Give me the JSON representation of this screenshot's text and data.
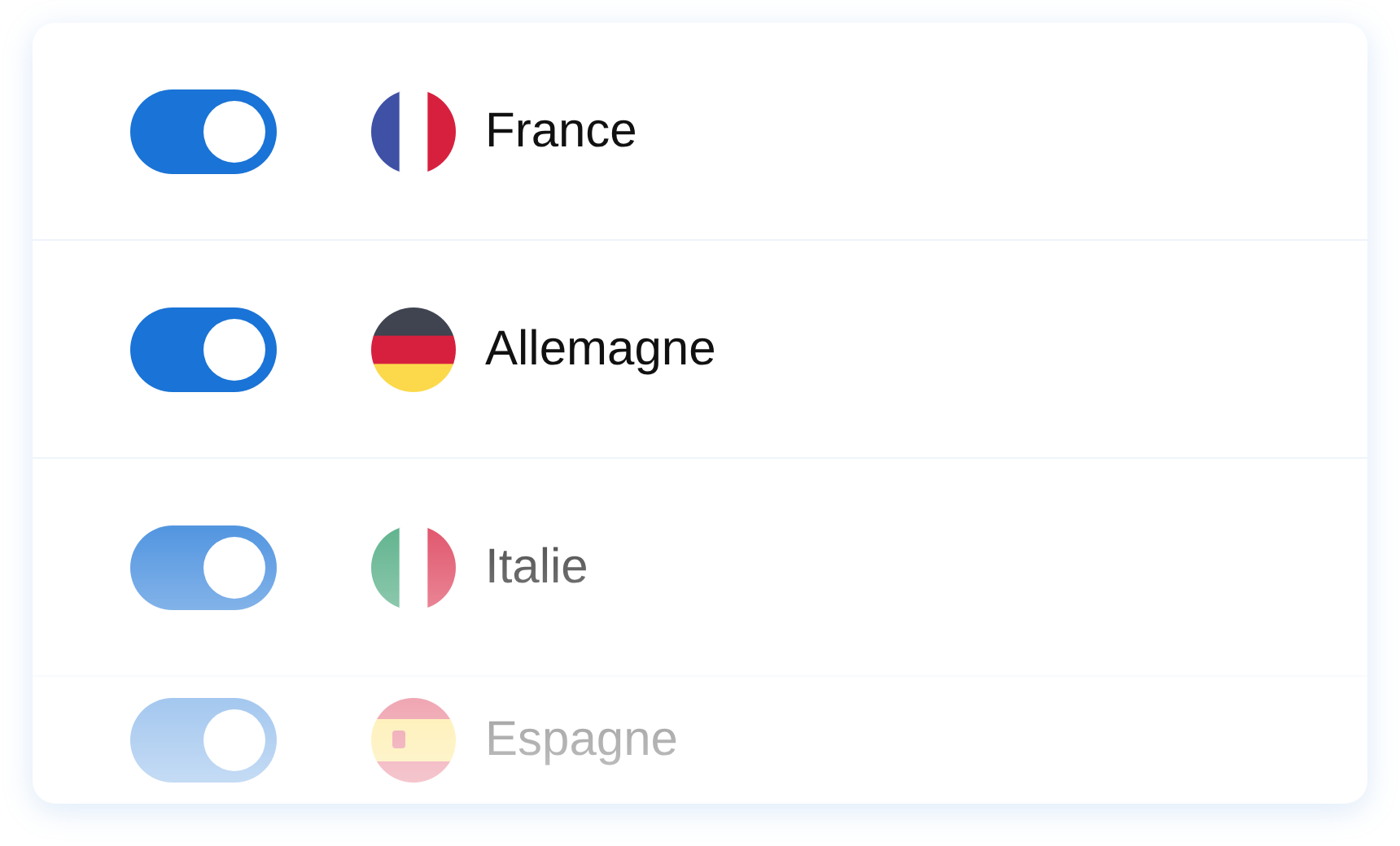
{
  "countries": [
    {
      "kind": "france",
      "name": "France",
      "on": true
    },
    {
      "kind": "germany",
      "name": "Allemagne",
      "on": true
    },
    {
      "kind": "italy",
      "name": "Italie",
      "on": true
    },
    {
      "kind": "spain",
      "name": "Espagne",
      "on": true
    }
  ]
}
